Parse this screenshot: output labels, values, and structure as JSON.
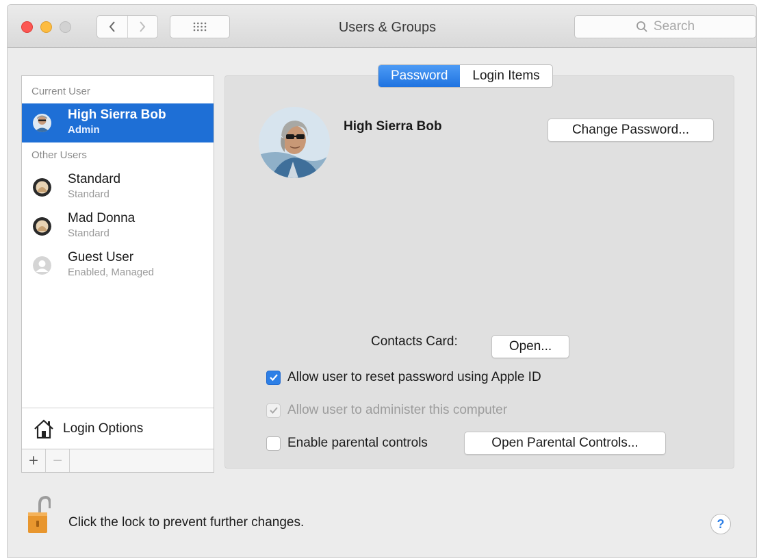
{
  "window": {
    "title": "Users & Groups"
  },
  "search": {
    "placeholder": "Search"
  },
  "sidebar": {
    "current_header": "Current User",
    "other_header": "Other Users",
    "users": [
      {
        "name": "High Sierra Bob",
        "role": "Admin",
        "selected": true
      },
      {
        "name": "Standard",
        "role": "Standard"
      },
      {
        "name": "Mad Donna",
        "role": "Standard"
      },
      {
        "name": "Guest User",
        "role": "Enabled, Managed"
      }
    ],
    "login_options": "Login Options",
    "add_label": "+",
    "remove_label": "−"
  },
  "tabs": [
    {
      "label": "Password",
      "active": true
    },
    {
      "label": "Login Items",
      "active": false
    }
  ],
  "main": {
    "user_name": "High Sierra Bob",
    "change_password_label": "Change Password...",
    "contacts_card_label": "Contacts Card:",
    "open_label": "Open...",
    "allow_reset": {
      "label": "Allow user to reset password using Apple ID",
      "checked": true
    },
    "allow_admin": {
      "label": "Allow user to administer this computer",
      "checked": true,
      "enabled": false
    },
    "parental": {
      "label": "Enable parental controls",
      "checked": false
    },
    "open_parental_label": "Open Parental Controls..."
  },
  "footer": {
    "lock_text": "Click the lock to prevent further changes.",
    "help_label": "?"
  },
  "colors": {
    "accent": "#1e6fd6",
    "lock": "#e8962e"
  }
}
